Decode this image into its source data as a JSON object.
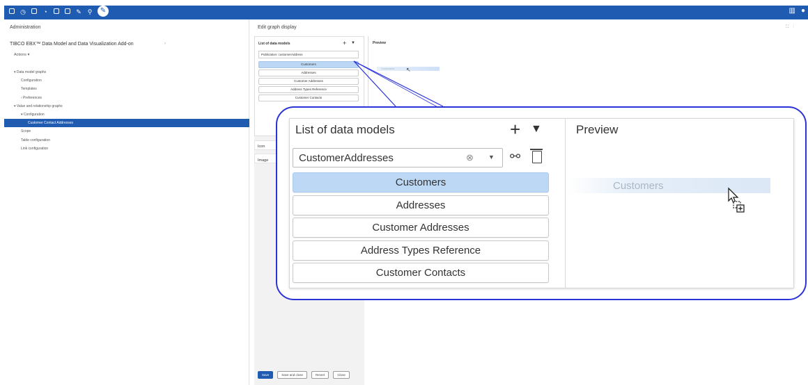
{
  "toolbar": {
    "icons": [
      "database-icon",
      "clock-icon",
      "document-icon",
      "gauge-icon",
      "report-icon",
      "document-gear-icon",
      "wrench-icon",
      "search-icon",
      "pencil-icon"
    ],
    "right_icons": [
      "book-icon",
      "user-icon"
    ]
  },
  "left": {
    "title": "Administration",
    "app_title": "TIBCO EBX™ Data Model and Data Visualization Add-on",
    "actions_label": "Actions ▾",
    "tree": [
      {
        "label": "▾ Data model graphs",
        "indent": 0
      },
      {
        "label": "Configuration",
        "indent": 1
      },
      {
        "label": "Templates",
        "indent": 1
      },
      {
        "label": "› Preferences",
        "indent": 1
      },
      {
        "label": "▾ Value and relationship graphs",
        "indent": 0
      },
      {
        "label": "▾ Configuration",
        "indent": 1
      },
      {
        "label": "Customer Contact Addresses",
        "indent": 2,
        "selected": true
      },
      {
        "label": "Scope",
        "indent": 1
      },
      {
        "label": "Table configuration",
        "indent": 1
      },
      {
        "label": "Link configuration",
        "indent": 1
      }
    ]
  },
  "center": {
    "title": "Edit graph display",
    "small_list": {
      "title": "List of data models",
      "select_value": "Publication: customerAddress",
      "items": [
        "Customers",
        "Addresses",
        "Customer Addresses",
        "Address Types Reference",
        "Customer Contacts"
      ]
    },
    "preview_title": "Preview",
    "preview_ghost": "Customers",
    "icon_label": "Icon",
    "image_label": "Image",
    "buttons": {
      "save": "Save",
      "save_close": "Save and close",
      "revert": "Revert",
      "close": "Close"
    }
  },
  "zoom": {
    "list_title": "List of data models",
    "plus": "+",
    "caret": "▾",
    "select_value": "CustomerAddresses",
    "items": [
      {
        "label": "Customers",
        "selected": true
      },
      {
        "label": "Addresses"
      },
      {
        "label": "Customer Addresses"
      },
      {
        "label": "Address Types Reference"
      },
      {
        "label": "Customer Contacts"
      }
    ],
    "preview_title": "Preview",
    "preview_ghost": "Customers"
  },
  "colors": {
    "brand": "#1f5bb0",
    "selected_item": "#bcd8f4",
    "callout_border": "#2a33d8"
  }
}
